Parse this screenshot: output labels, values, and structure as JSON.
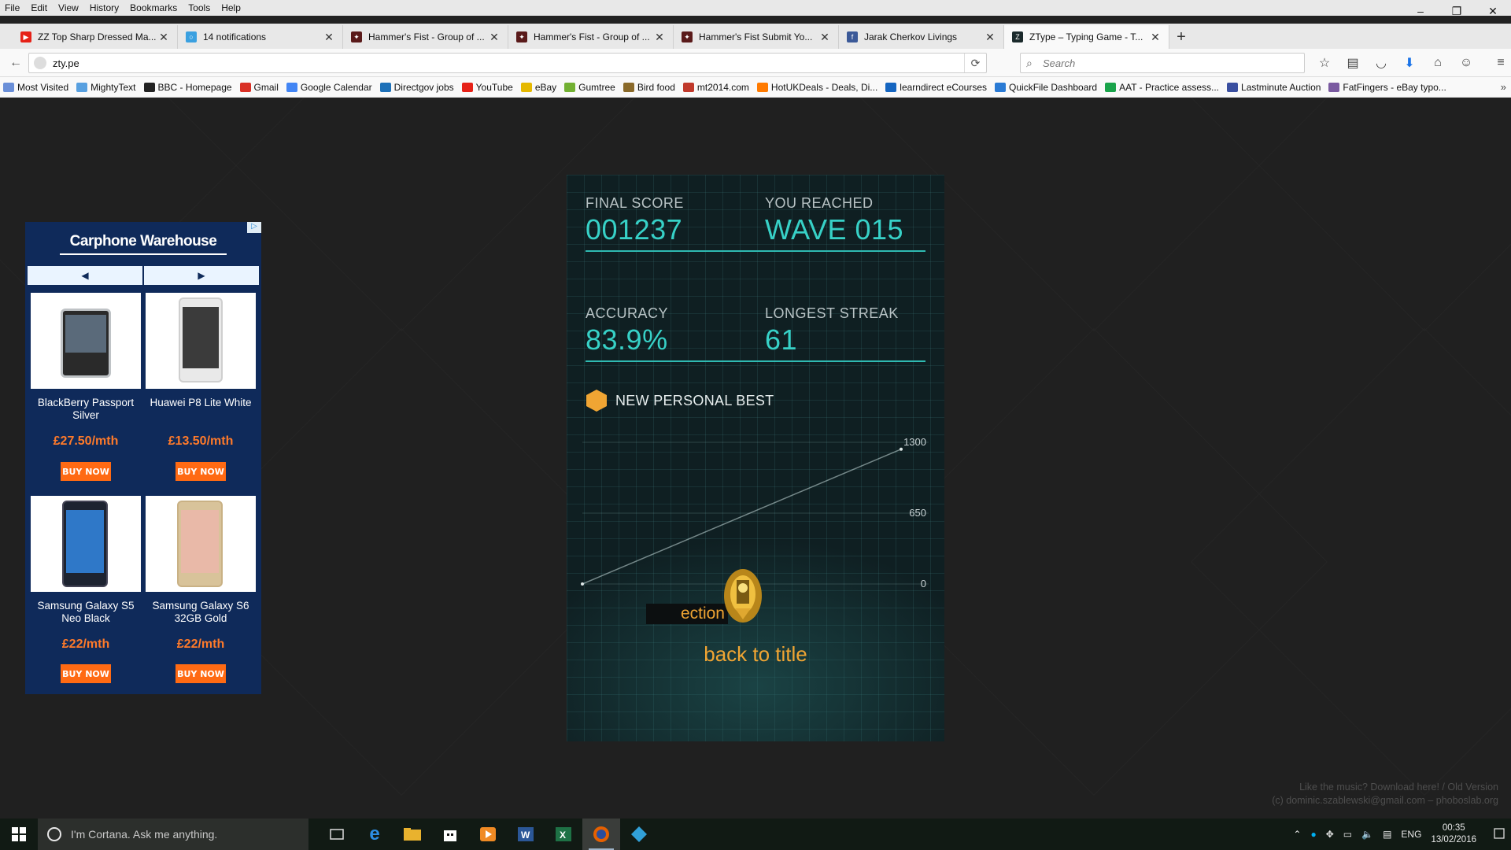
{
  "menubar": [
    "File",
    "Edit",
    "View",
    "History",
    "Bookmarks",
    "Tools",
    "Help"
  ],
  "window_controls": {
    "minimize": "–",
    "restore": "❐",
    "close": "✕"
  },
  "tabs": [
    {
      "title": "ZZ Top Sharp Dressed Ma...",
      "favicon_color": "#e62117",
      "favicon": "▶"
    },
    {
      "title": "14 notifications",
      "favicon_color": "#3aa0e0",
      "favicon": "○"
    },
    {
      "title": "Hammer's Fist - Group of ...",
      "favicon_color": "#5a1a1a",
      "favicon": "✦"
    },
    {
      "title": "Hammer's Fist - Group of ...",
      "favicon_color": "#5a1a1a",
      "favicon": "✦"
    },
    {
      "title": "Hammer's Fist Submit Yo...",
      "favicon_color": "#5a1a1a",
      "favicon": "✦"
    },
    {
      "title": "Jarak Cherkov Livings",
      "favicon_color": "#3b5998",
      "favicon": "f"
    },
    {
      "title": "ZType – Typing Game - T...",
      "favicon_color": "#1b2a2c",
      "favicon": "Z",
      "active": true
    }
  ],
  "address": {
    "url": "zty.pe",
    "search_placeholder": "Search"
  },
  "bookmarks": [
    {
      "label": "Most Visited",
      "color": "#6a8fd8"
    },
    {
      "label": "MightyText",
      "color": "#58a0e0"
    },
    {
      "label": "BBC - Homepage",
      "color": "#222222"
    },
    {
      "label": "Gmail",
      "color": "#d93025"
    },
    {
      "label": "Google Calendar",
      "color": "#4285f4"
    },
    {
      "label": "Directgov jobs",
      "color": "#1d70b8"
    },
    {
      "label": "YouTube",
      "color": "#e62117"
    },
    {
      "label": "eBay",
      "color": "#e5b800"
    },
    {
      "label": "Gumtree",
      "color": "#72b032"
    },
    {
      "label": "Bird food",
      "color": "#8a6a2a"
    },
    {
      "label": "mt2014.com",
      "color": "#c0392b"
    },
    {
      "label": "HotUKDeals - Deals, Di...",
      "color": "#ff7a00"
    },
    {
      "label": "learndirect eCourses",
      "color": "#1565c0"
    },
    {
      "label": "QuickFile Dashboard",
      "color": "#2a7ad4"
    },
    {
      "label": "AAT - Practice assess...",
      "color": "#19a34a"
    },
    {
      "label": "Lastminute Auction",
      "color": "#3a4fa0"
    },
    {
      "label": "FatFingers - eBay typo...",
      "color": "#7a5aa0"
    }
  ],
  "ad": {
    "brand": "Carphone Warehouse",
    "prev": "◀",
    "next": "▶",
    "buy_label": "BUY NOW",
    "products": [
      {
        "name": "BlackBerry Passport Silver",
        "price": "£27.50/mth"
      },
      {
        "name": "Huawei P8 Lite White",
        "price": "£13.50/mth"
      },
      {
        "name": "Samsung Galaxy S5 Neo Black",
        "price": "£22/mth"
      },
      {
        "name": "Samsung Galaxy S6 32GB Gold",
        "price": "£22/mth"
      }
    ]
  },
  "game": {
    "final_score_label": "FINAL SCORE",
    "final_score": "001237",
    "wave_label": "YOU REACHED",
    "wave": "WAVE 015",
    "accuracy_label": "ACCURACY",
    "accuracy": "83.9%",
    "streak_label": "LONGEST STREAK",
    "streak": "61",
    "personal_best": "NEW PERSONAL BEST",
    "partial_word": "ection",
    "back_to_title": "back to title",
    "accent": "#37d1c7",
    "orange": "#f0a533"
  },
  "chart_data": {
    "type": "line",
    "ylim": [
      0,
      1300
    ],
    "y_ticks": [
      "1300",
      "650",
      "0"
    ],
    "series": [
      {
        "x": [
          0,
          1
        ],
        "values": [
          0,
          1237
        ]
      }
    ]
  },
  "credits": {
    "line1": "Like the music? Download here! / Old Version",
    "line2": "(c) dominic.szablewski@gmail.com – phoboslab.org"
  },
  "taskbar": {
    "cortana_placeholder": "I'm Cortana. Ask me anything.",
    "lang": "ENG",
    "time": "00:35",
    "date": "13/02/2016"
  }
}
